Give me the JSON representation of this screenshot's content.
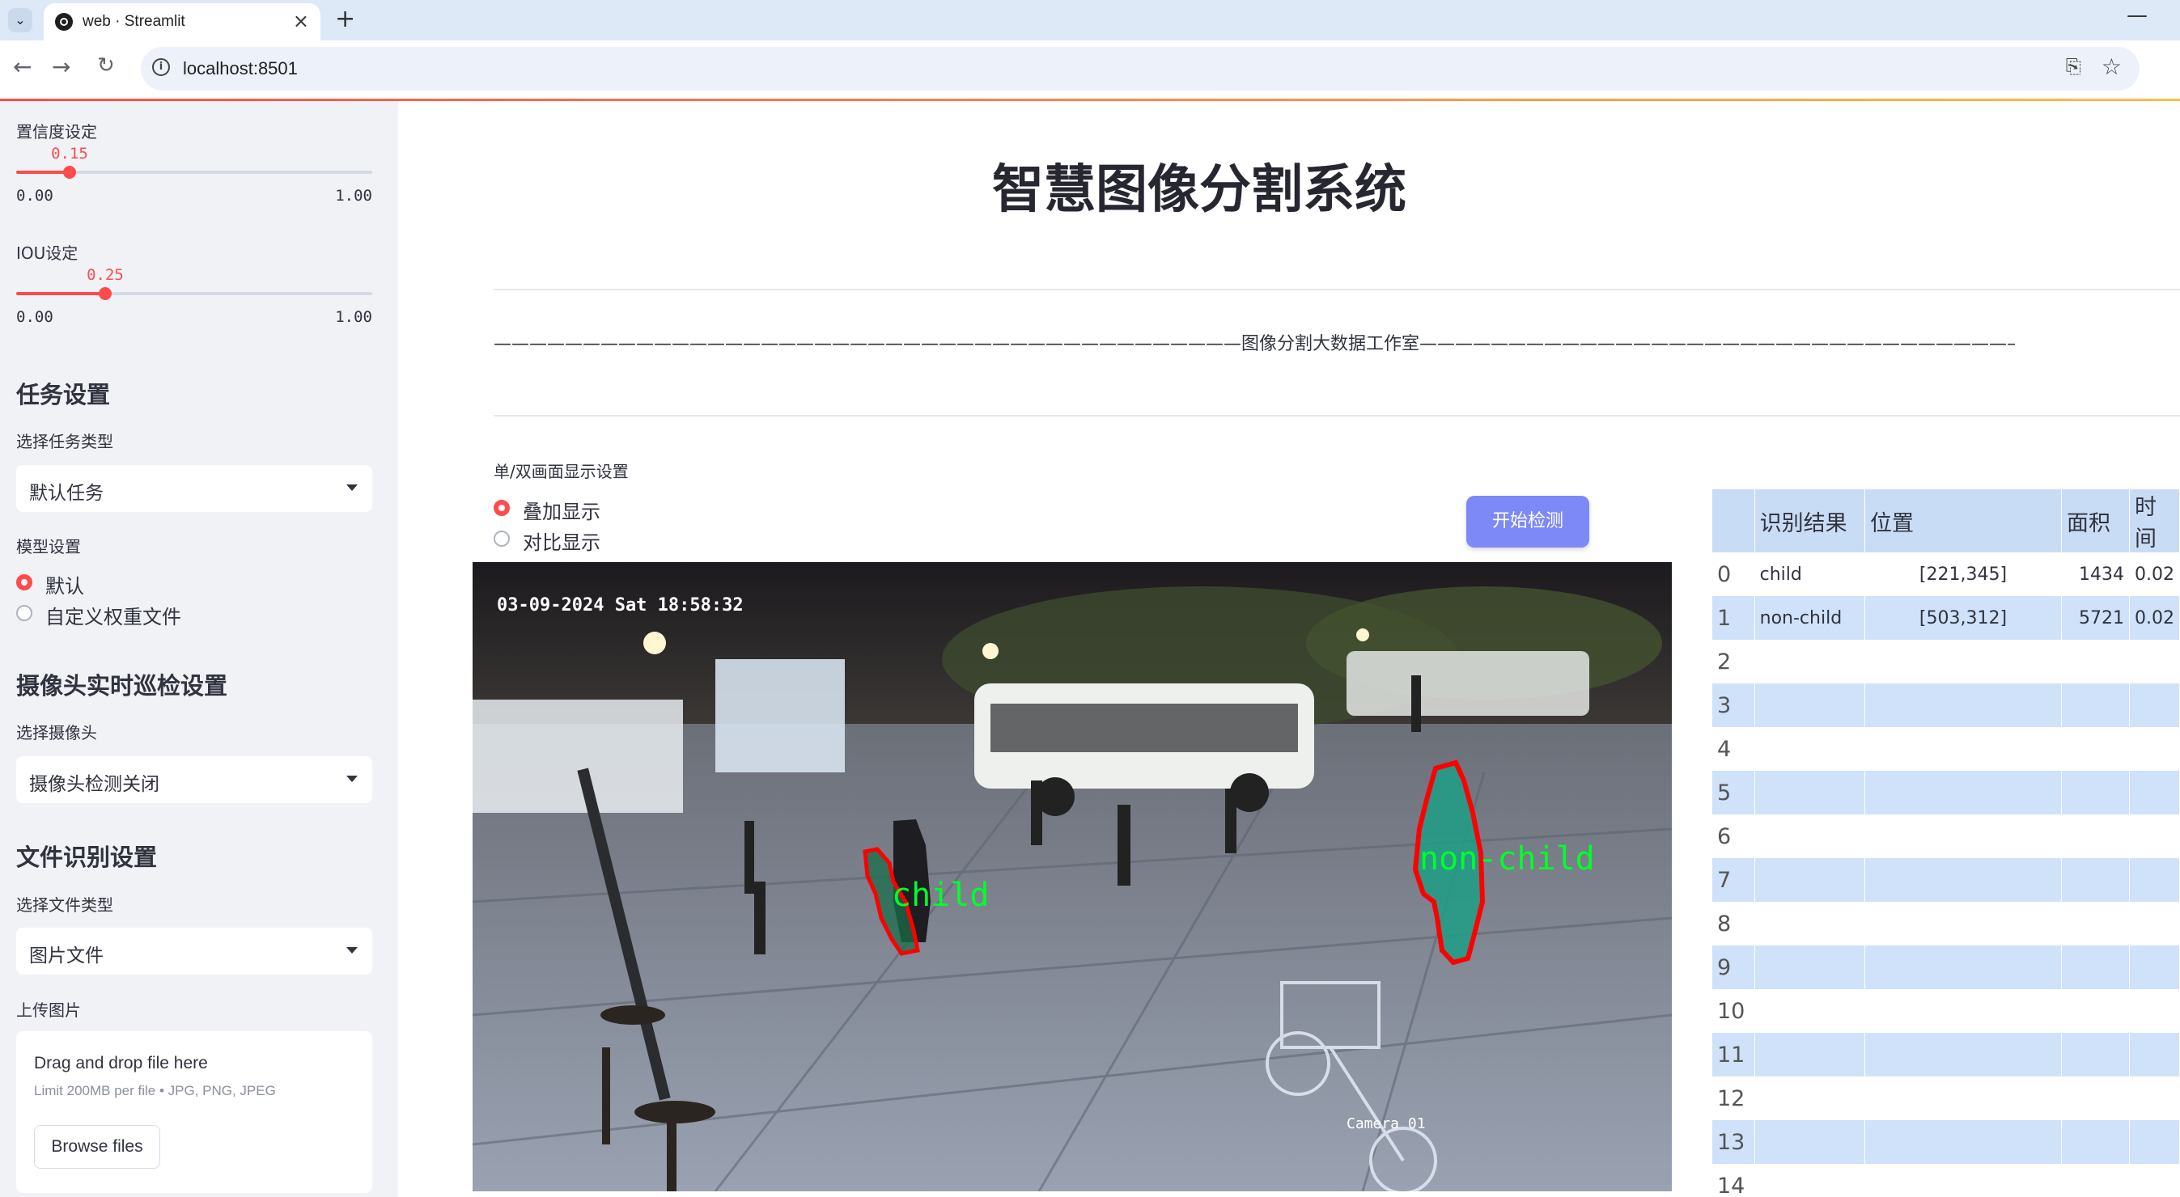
{
  "browser": {
    "tab_title": "web · Streamlit",
    "url": "localhost:8501"
  },
  "sidebar": {
    "confidence": {
      "label": "置信度设定",
      "value": "0.15",
      "min": "0.00",
      "max": "1.00",
      "fraction": 0.15
    },
    "iou": {
      "label": "IOU设定",
      "value": "0.25",
      "min": "0.00",
      "max": "1.00",
      "fraction": 0.25
    },
    "task": {
      "heading": "任务设置",
      "select_label": "选择任务类型",
      "selected": "默认任务"
    },
    "model": {
      "label": "模型设置",
      "options": [
        "默认",
        "自定义权重文件"
      ],
      "selected_index": 0
    },
    "camera": {
      "heading": "摄像头实时巡检设置",
      "select_label": "选择摄像头",
      "selected": "摄像头检测关闭"
    },
    "file": {
      "heading": "文件识别设置",
      "select_label": "选择文件类型",
      "selected": "图片文件",
      "upload_label": "上传图片"
    },
    "upload": {
      "drag_text": "Drag and drop file here",
      "limit_text": "Limit 200MB per file • JPG, PNG, JPEG",
      "browse_label": "Browse files"
    }
  },
  "main": {
    "title": "智慧图像分割系统",
    "divider_text": "——————————————————————————————————————————图像分割大数据工作室——————————————————————————————————————————",
    "display_label": "单/双画面显示设置",
    "display_options": [
      "叠加显示",
      "对比显示"
    ],
    "display_selected_index": 0,
    "start_button": "开始检测",
    "image": {
      "timestamp": "03-09-2024 Sat 18:58:32",
      "camera_label": "Camera 01",
      "detections": [
        {
          "label": "child"
        },
        {
          "label": "non-child"
        }
      ]
    },
    "table": {
      "headers": [
        "",
        "识别结果",
        "位置",
        "面积",
        "时间"
      ],
      "rows": [
        [
          "0",
          "child",
          "[221,345]",
          "1434",
          "0.02"
        ],
        [
          "1",
          "non-child",
          "[503,312]",
          "5721",
          "0.02"
        ],
        [
          "2",
          "",
          "",
          "",
          ""
        ],
        [
          "3",
          "",
          "",
          "",
          ""
        ],
        [
          "4",
          "",
          "",
          "",
          ""
        ],
        [
          "5",
          "",
          "",
          "",
          ""
        ],
        [
          "6",
          "",
          "",
          "",
          ""
        ],
        [
          "7",
          "",
          "",
          "",
          ""
        ],
        [
          "8",
          "",
          "",
          "",
          ""
        ],
        [
          "9",
          "",
          "",
          "",
          ""
        ],
        [
          "10",
          "",
          "",
          "",
          ""
        ],
        [
          "11",
          "",
          "",
          "",
          ""
        ],
        [
          "12",
          "",
          "",
          "",
          ""
        ],
        [
          "13",
          "",
          "",
          "",
          ""
        ],
        [
          "14",
          "",
          "",
          "",
          ""
        ]
      ]
    }
  },
  "colors": {
    "accent": "#ff4b4b",
    "button": "#7d89f6",
    "table_header": "#c9dcf6",
    "mask_outline": "#ff0000",
    "label_green": "#00ff2a"
  }
}
